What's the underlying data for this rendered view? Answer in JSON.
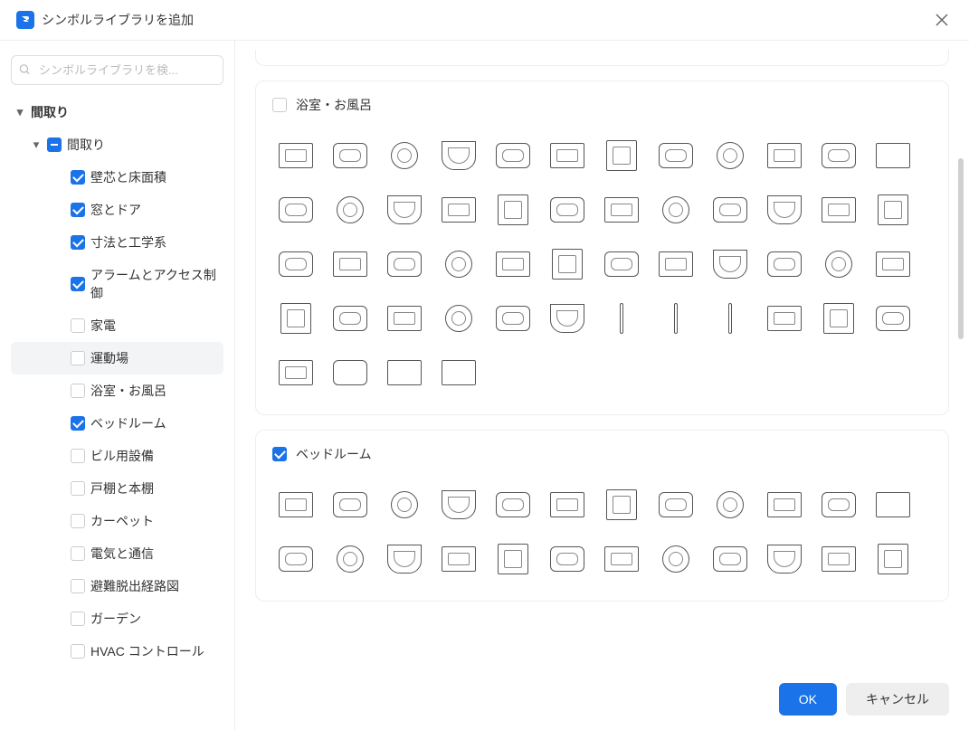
{
  "header": {
    "title": "シンボルライブラリを追加"
  },
  "search": {
    "placeholder": "シンボルライブラリを検..."
  },
  "sidebar": {
    "topLabel": "間取り",
    "groupLabel": "間取り",
    "items": [
      {
        "label": "壁芯と床面積",
        "checked": true
      },
      {
        "label": "窓とドア",
        "checked": true
      },
      {
        "label": "寸法と工学系",
        "checked": true
      },
      {
        "label": "アラームとアクセス制御",
        "checked": true
      },
      {
        "label": "家電",
        "checked": false
      },
      {
        "label": "運動場",
        "checked": false,
        "active": true
      },
      {
        "label": "浴室・お風呂",
        "checked": false
      },
      {
        "label": "ベッドルーム",
        "checked": true
      },
      {
        "label": "ビル用設備",
        "checked": false
      },
      {
        "label": "戸棚と本棚",
        "checked": false
      },
      {
        "label": "カーペット",
        "checked": false
      },
      {
        "label": "電気と通信",
        "checked": false
      },
      {
        "label": "避難脱出経路図",
        "checked": false
      },
      {
        "label": "ガーデン",
        "checked": false
      },
      {
        "label": "HVAC コントロール",
        "checked": false
      }
    ]
  },
  "sections": {
    "bath": {
      "title": "浴室・お風呂",
      "checked": false,
      "symbolCount": 52
    },
    "bedroom": {
      "title": "ベッドルーム",
      "checked": true,
      "symbolCount": 24
    }
  },
  "footer": {
    "ok": "OK",
    "cancel": "キャンセル"
  }
}
